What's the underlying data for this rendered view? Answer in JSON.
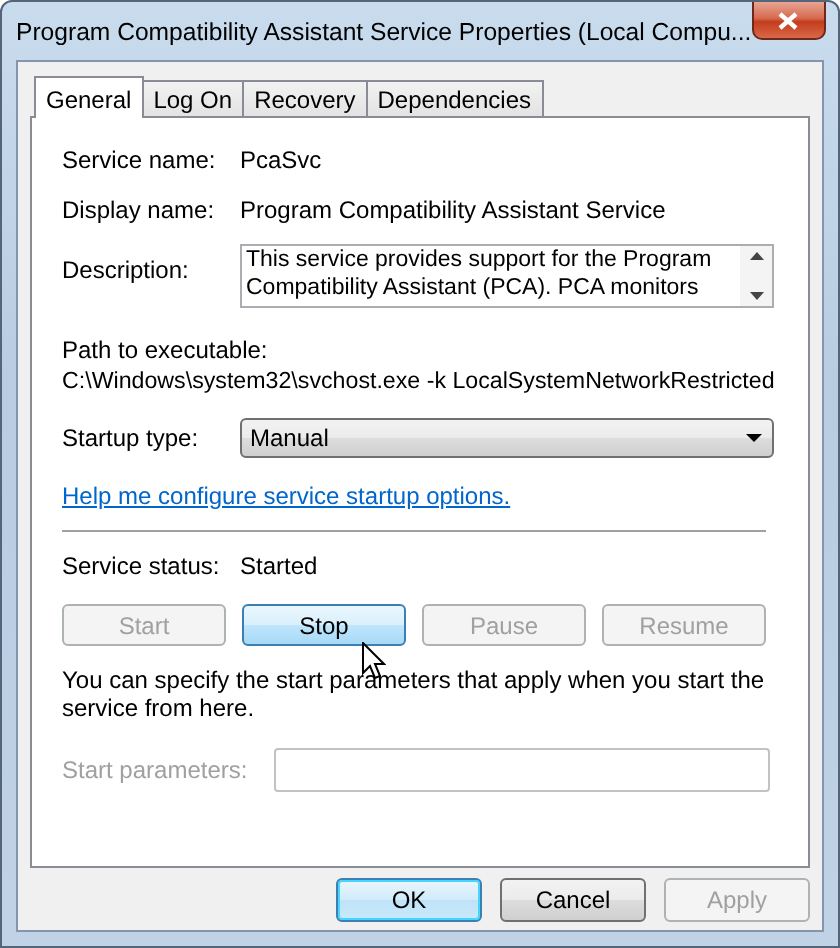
{
  "window": {
    "title": "Program Compatibility Assistant Service Properties (Local Compu..."
  },
  "tabs": [
    {
      "label": "General",
      "selected": true
    },
    {
      "label": "Log On",
      "selected": false
    },
    {
      "label": "Recovery",
      "selected": false
    },
    {
      "label": "Dependencies",
      "selected": false
    }
  ],
  "service_name": {
    "label": "Service name:",
    "value": "PcaSvc"
  },
  "display_name": {
    "label": "Display name:",
    "value": "Program Compatibility Assistant Service"
  },
  "description": {
    "label": "Description:",
    "lines": [
      "This service provides support for the Program",
      "Compatibility Assistant (PCA).  PCA monitors"
    ]
  },
  "path": {
    "label": "Path to executable:",
    "value": "C:\\Windows\\system32\\svchost.exe -k LocalSystemNetworkRestricted"
  },
  "startup_type": {
    "label": "Startup type:",
    "value": "Manual"
  },
  "help_link": "Help me configure service startup options.",
  "service_status": {
    "label": "Service status:",
    "value": "Started"
  },
  "service_buttons": [
    {
      "label": "Start",
      "disabled": true,
      "hovered": false
    },
    {
      "label": "Stop",
      "disabled": false,
      "hovered": true
    },
    {
      "label": "Pause",
      "disabled": true,
      "hovered": false
    },
    {
      "label": "Resume",
      "disabled": true,
      "hovered": false
    }
  ],
  "start_note": "You can specify the start parameters that apply when you start the service from here.",
  "start_parameters": {
    "label": "Start parameters:",
    "disabled": true
  },
  "dialog_buttons": [
    {
      "label": "OK",
      "disabled": false,
      "default": true
    },
    {
      "label": "Cancel",
      "disabled": false,
      "default": false
    },
    {
      "label": "Apply",
      "disabled": true,
      "default": false
    }
  ]
}
